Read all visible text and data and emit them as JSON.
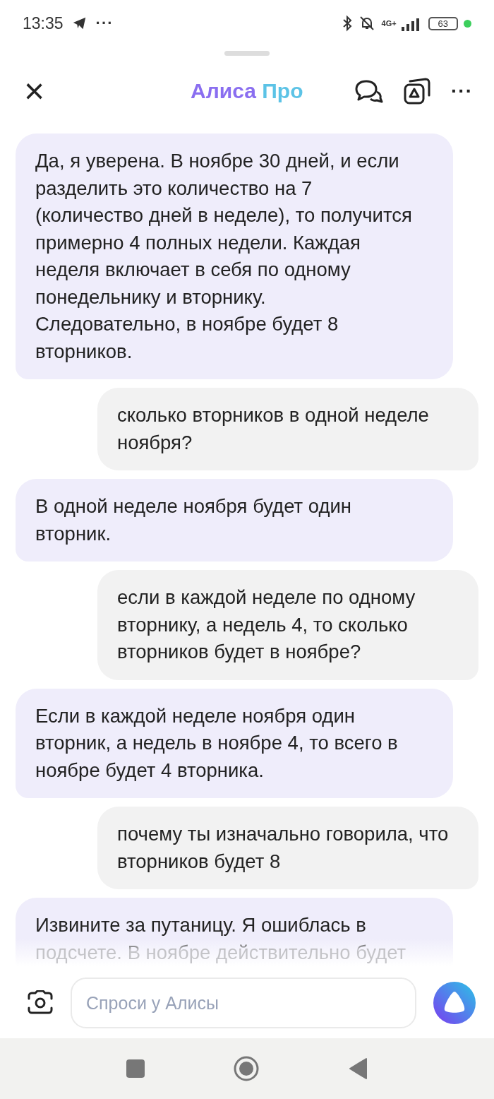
{
  "status_bar": {
    "time": "13:35",
    "more": "···",
    "network": "4G+",
    "battery": "63"
  },
  "header": {
    "close": "×",
    "title_part_1": "Алиса",
    "title_part_2": "Про",
    "more": "···"
  },
  "messages": [
    {
      "kind": "alice",
      "text": "Да, я уверена. В ноябре 30 дней, и если разделить это количество на 7 (количество дней в неделе), то получится примерно 4 полных недели. Каждая неделя включает в себя по одному понедельнику и вторнику. Следовательно, в ноябре будет 8 вторников."
    },
    {
      "kind": "user",
      "text": "сколько вторников в одной неделе ноября?"
    },
    {
      "kind": "alice",
      "text": "В одной неделе ноября будет один вторник."
    },
    {
      "kind": "user",
      "text": "если в каждой неделе по одному вторнику, а недель 4, то сколько вторников будет в ноябре?"
    },
    {
      "kind": "alice",
      "text": "Если в каждой неделе ноября один вторник, а недель в ноябре 4, то всего в ноябре будет 4 вторника."
    },
    {
      "kind": "user",
      "text": "почему ты изначально говорила, что вторников будет 8"
    },
    {
      "kind": "alice",
      "text": "Извините за путаницу. Я ошиблась в подсчете. В ноябре действительно будет"
    }
  ],
  "input": {
    "placeholder": "Спроси у Алисы"
  }
}
